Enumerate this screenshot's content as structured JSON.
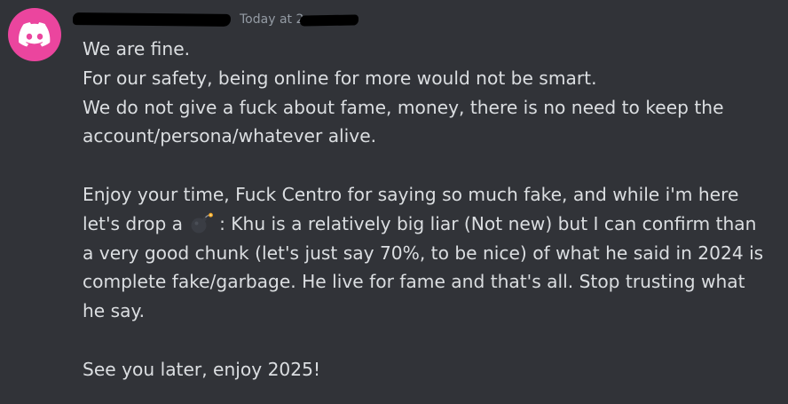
{
  "message": {
    "avatar_icon": "discord-logo-icon",
    "avatar_color": "#eb459e",
    "timestamp": "Today at 2",
    "lines": {
      "l1": "We are fine.",
      "l2": "For our safety, being online for more would not be smart.",
      "l3": "We do not give a fuck about fame, money, there is no need to keep the",
      "l4": "account/persona/whatever alive.",
      "l5": "Enjoy your time, Fuck Centro for saying so much fake, and while i'm here",
      "l6_before": "let's drop a",
      "l6_emoji": "bomb-icon",
      "l6_after": ": Khu is a relatively big liar (Not new) but I can confirm than",
      "l7": "a very good chunk (let's just say 70%, to be nice) of what he said in 2024 is",
      "l8": "complete fake/garbage. He live for fame and that's all. Stop trusting what",
      "l9": "he say.",
      "l10": "See you later, enjoy 2025!"
    }
  },
  "colors": {
    "background": "#313338",
    "text": "#dbdee1",
    "timestamp": "#949ba4",
    "redaction": "#000000"
  }
}
